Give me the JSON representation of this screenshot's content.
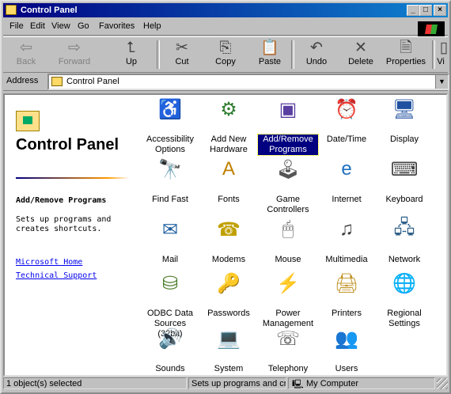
{
  "window": {
    "title": "Control Panel"
  },
  "menu": [
    "File",
    "Edit",
    "View",
    "Go",
    "Favorites",
    "Help"
  ],
  "toolbar": [
    {
      "label": "Back",
      "icon": "back-arrow-icon",
      "enabled": false
    },
    {
      "label": "Forward",
      "icon": "forward-arrow-icon",
      "enabled": false
    },
    {
      "label": "Up",
      "icon": "up-folder-icon",
      "enabled": true
    },
    {
      "label": "Cut",
      "icon": "scissors-icon",
      "enabled": true
    },
    {
      "label": "Copy",
      "icon": "copy-icon",
      "enabled": true
    },
    {
      "label": "Paste",
      "icon": "paste-icon",
      "enabled": true
    },
    {
      "label": "Undo",
      "icon": "undo-icon",
      "enabled": true
    },
    {
      "label": "Delete",
      "icon": "delete-x-icon",
      "enabled": true
    },
    {
      "label": "Properties",
      "icon": "properties-icon",
      "enabled": true
    },
    {
      "label": "Vi",
      "icon": "views-icon",
      "enabled": true
    }
  ],
  "address": {
    "label": "Address",
    "value": "Control Panel"
  },
  "left_pane": {
    "title": "Control Panel",
    "selected_name": "Add/Remove Programs",
    "selected_desc": "Sets up programs and creates shortcuts.",
    "links": [
      "Microsoft Home",
      "Technical Support"
    ]
  },
  "items": [
    {
      "label": "Accessibility Options",
      "icon": "accessibility-icon",
      "glyph": "♿",
      "color": "#1a4fb0",
      "selected": false
    },
    {
      "label": "Add New Hardware",
      "icon": "add-hardware-icon",
      "glyph": "⚙",
      "color": "#2f7d2f",
      "selected": false
    },
    {
      "label": "Add/Remove Programs",
      "icon": "add-remove-programs-icon",
      "glyph": "▣",
      "color": "#5a3ea0",
      "selected": true
    },
    {
      "label": "Date/Time",
      "icon": "date-time-icon",
      "glyph": "⏰",
      "color": "#b03020",
      "selected": false
    },
    {
      "label": "Display",
      "icon": "display-icon",
      "glyph": "🖥",
      "color": "#2050a0",
      "selected": false
    },
    {
      "label": "Find Fast",
      "icon": "find-fast-icon",
      "glyph": "🔭",
      "color": "#333333",
      "selected": false
    },
    {
      "label": "Fonts",
      "icon": "fonts-folder-icon",
      "glyph": "A",
      "color": "#c08000",
      "selected": false
    },
    {
      "label": "Game Controllers",
      "icon": "joystick-icon",
      "glyph": "🕹",
      "color": "#555555",
      "selected": false
    },
    {
      "label": "Internet",
      "icon": "internet-icon",
      "glyph": "e",
      "color": "#1e70c0",
      "selected": false
    },
    {
      "label": "Keyboard",
      "icon": "keyboard-icon",
      "glyph": "⌨",
      "color": "#444444",
      "selected": false
    },
    {
      "label": "Mail",
      "icon": "mail-icon",
      "glyph": "✉",
      "color": "#2060a0",
      "selected": false
    },
    {
      "label": "Modems",
      "icon": "modem-phone-icon",
      "glyph": "☎",
      "color": "#c0a000",
      "selected": false
    },
    {
      "label": "Mouse",
      "icon": "mouse-icon",
      "glyph": "🖱",
      "color": "#555555",
      "selected": false
    },
    {
      "label": "Multimedia",
      "icon": "multimedia-icon",
      "glyph": "♫",
      "color": "#404040",
      "selected": false
    },
    {
      "label": "Network",
      "icon": "network-icon",
      "glyph": "🖧",
      "color": "#30608a",
      "selected": false
    },
    {
      "label": "ODBC Data Sources (32bit)",
      "icon": "odbc-icon",
      "glyph": "⛁",
      "color": "#4a7a2a",
      "selected": false
    },
    {
      "label": "Passwords",
      "icon": "passwords-key-icon",
      "glyph": "🔑",
      "color": "#c09000",
      "selected": false
    },
    {
      "label": "Power Management",
      "icon": "power-management-icon",
      "glyph": "⚡",
      "color": "#3070a0",
      "selected": false
    },
    {
      "label": "Printers",
      "icon": "printers-icon",
      "glyph": "🖨",
      "color": "#c09020",
      "selected": false
    },
    {
      "label": "Regional Settings",
      "icon": "globe-icon",
      "glyph": "🌐",
      "color": "#20a040",
      "selected": false
    },
    {
      "label": "Sounds",
      "icon": "sounds-icon",
      "glyph": "🔊",
      "color": "#2060a0",
      "selected": false
    },
    {
      "label": "System",
      "icon": "system-computer-icon",
      "glyph": "💻",
      "color": "#404040",
      "selected": false
    },
    {
      "label": "Telephony",
      "icon": "telephony-icon",
      "glyph": "☏",
      "color": "#404040",
      "selected": false
    },
    {
      "label": "Users",
      "icon": "users-icon",
      "glyph": "👥",
      "color": "#a03020",
      "selected": false
    }
  ],
  "status": {
    "left": "1 object(s) selected",
    "middle": "Sets up programs and cre",
    "right": "My Computer"
  }
}
